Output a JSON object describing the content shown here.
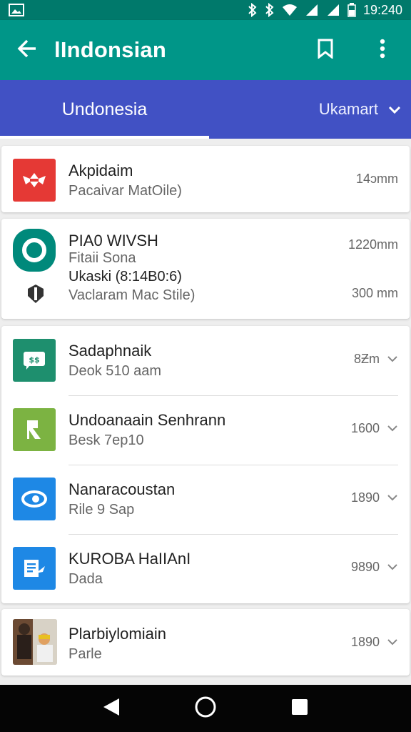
{
  "status_bar": {
    "time": "19:240"
  },
  "app_bar": {
    "title": "lIndonsian"
  },
  "tabs": {
    "active": "Undonesia",
    "dropdown": "Ukamart"
  },
  "cards": [
    {
      "items": [
        {
          "name": "Akpidaim",
          "sub": "Pacaivar MatOile)",
          "size": "14ɔmm",
          "icon_color": "#e53935"
        }
      ]
    },
    {
      "items": [
        {
          "name": "PIA0 WIVSH",
          "sub1": "Fitaii Sona",
          "sub2": "Ukaski (8:14B0:6)",
          "sub3": "Vaclaram Mac Stile)",
          "size1": "1220mm",
          "size2": "300 mm",
          "icon_color": "#00897b"
        }
      ]
    },
    {
      "items": [
        {
          "name": "Sadaphnaik",
          "sub": "Deok 510 aam",
          "size": "8Ƶm",
          "icon_color": "#1e8f6e"
        },
        {
          "name": "Undoanaain Senhrann",
          "sub": "Besk 7ep10",
          "size": "1600",
          "icon_color": "#7cb342"
        },
        {
          "name": "Nanaracoustan",
          "sub": "Rile 9 Sap",
          "size": "1890",
          "icon_color": "#1e88e5"
        },
        {
          "name": "KUROBA HaIIAnI",
          "sub": "Dada",
          "size": "9890",
          "icon_color": "#1e88e5"
        }
      ]
    },
    {
      "items": [
        {
          "name": "Plarbiylomiain",
          "sub": "Parle",
          "size": "1890"
        }
      ]
    }
  ]
}
